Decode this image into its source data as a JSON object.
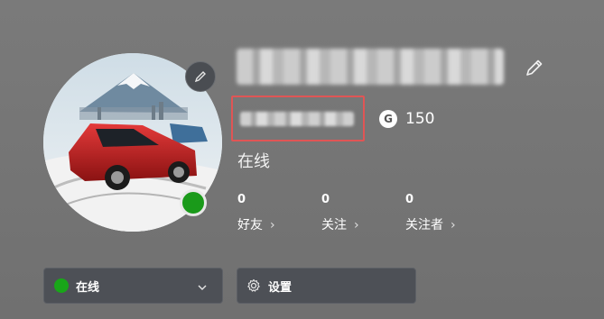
{
  "profile": {
    "gamertag": "",
    "sub_name": "",
    "score": "150",
    "score_icon": "G",
    "status": "在线"
  },
  "stats": [
    {
      "count": "0",
      "label": "好友"
    },
    {
      "count": "0",
      "label": "关注"
    },
    {
      "count": "0",
      "label": "关注者"
    }
  ],
  "buttons": {
    "status_label": "在线",
    "settings_label": "设置"
  },
  "colors": {
    "online": "#19a619",
    "highlight_box": "#e05555",
    "button_bg": "#4d5056"
  },
  "icons": [
    "pencil-icon",
    "chevron-right-icon",
    "chevron-down-icon",
    "gear-icon"
  ]
}
